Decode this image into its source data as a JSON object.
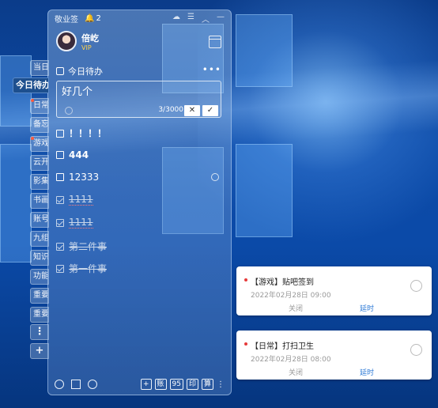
{
  "app": {
    "title": "敬业签",
    "badge_count": "2"
  },
  "user": {
    "name": "倍屹",
    "vip": "VIP"
  },
  "side_tabs": [
    {
      "label": "当日",
      "active": false
    },
    {
      "label": "今日待办",
      "active": true
    },
    {
      "label": "日常",
      "active": false
    },
    {
      "label": "备忘",
      "active": false
    },
    {
      "label": "游戏",
      "active": false
    },
    {
      "label": "云开",
      "active": false
    },
    {
      "label": "影集",
      "active": false
    },
    {
      "label": "书画",
      "active": false
    },
    {
      "label": "账号",
      "active": false
    },
    {
      "label": "九组",
      "active": false
    },
    {
      "label": "知识",
      "active": false
    },
    {
      "label": "功能",
      "active": false
    },
    {
      "label": "重要",
      "active": false
    },
    {
      "label": "重要",
      "active": false
    }
  ],
  "side_buttons": {
    "more": "⋮",
    "add": "+"
  },
  "list": {
    "title": "今日待办",
    "more": "•••",
    "editor_value": "好几个",
    "char_count": "3/3000",
    "cancel": "✕",
    "confirm": "✓"
  },
  "todos": [
    {
      "text": "！！！！",
      "done": false
    },
    {
      "text": "444",
      "done": false
    },
    {
      "text": "12333",
      "done": false
    },
    {
      "text": "1111",
      "done": true
    },
    {
      "text": "1111",
      "done": true
    },
    {
      "text": "第二件事",
      "done": true
    },
    {
      "text": "第一件事",
      "done": true
    }
  ],
  "bottom_bar": [
    "+",
    "账",
    "95",
    "印",
    "算",
    "⋮"
  ],
  "notifications": [
    {
      "title": "【游戏】贴吧签到",
      "time": "2022年02月28日 09:00",
      "close": "关闭",
      "later": "延时"
    },
    {
      "title": "【日常】打扫卫生",
      "time": "2022年02月28日 08:00",
      "close": "关闭",
      "later": "延时"
    }
  ]
}
